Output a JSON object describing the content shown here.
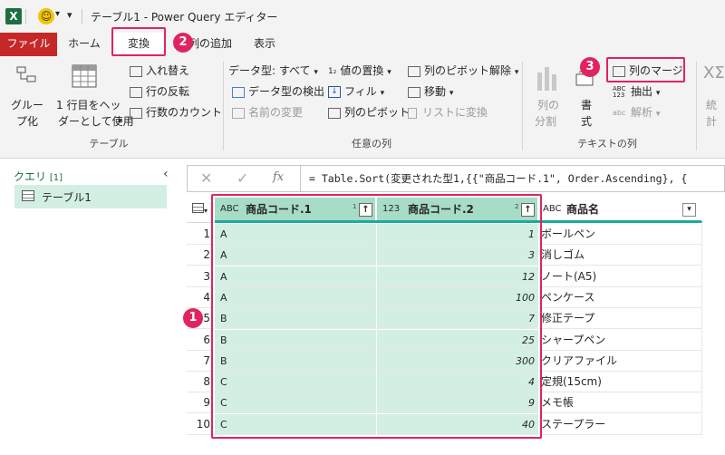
{
  "titlebar": {
    "title": "テーブル1 - Power Query エディター",
    "qat_dropdown": "▾"
  },
  "tabs": {
    "file": "ファイル",
    "home": "ホーム",
    "transform": "変換",
    "add_column": "列の追加",
    "view": "表示"
  },
  "ribbon": {
    "group_by": [
      "グルー",
      "プ化"
    ],
    "use_first_row": [
      "1 行目をヘッ",
      "ダーとして使用"
    ],
    "transpose": "入れ替え",
    "reverse_rows": "行の反転",
    "count_rows": "行数のカウント",
    "data_type": "データ型: すべて",
    "detect_type": "データ型の検出",
    "rename": "名前の変更",
    "replace_values": "値の置換",
    "fill": "フィル",
    "pivot_column": "列のピボット",
    "unpivot": "列のピボット解除",
    "move": "移動",
    "to_list": "リストに変換",
    "split_column": [
      "列の",
      "分割"
    ],
    "format": [
      "書",
      "式"
    ],
    "merge_columns": "列のマージ",
    "extract": "抽出",
    "parse": "解析",
    "stats": [
      "統",
      "計"
    ],
    "extract_icon_label": "ABC\n123",
    "groups": {
      "table": "テーブル",
      "any_column": "任意の列",
      "text_column": "テキストの列"
    }
  },
  "queries": {
    "title": "クエリ",
    "count": "[1]",
    "items": [
      "テーブル1"
    ]
  },
  "formula": {
    "fx": "fx",
    "text": "= Table.Sort(変更された型1,{{\"商品コード.1\", Order.Ascending}, {"
  },
  "grid": {
    "columns": [
      {
        "type": "ABC",
        "name": "商品コード.1",
        "sort_index": "1"
      },
      {
        "type": "123",
        "name": "商品コード.2",
        "sort_index": "2"
      },
      {
        "type": "ABC",
        "name": "商品名"
      }
    ],
    "rows": [
      {
        "n": "1",
        "c1": "A",
        "c2": "1",
        "c3": "ボールペン"
      },
      {
        "n": "2",
        "c1": "A",
        "c2": "3",
        "c3": "消しゴム"
      },
      {
        "n": "3",
        "c1": "A",
        "c2": "12",
        "c3": "ノート(A5)"
      },
      {
        "n": "4",
        "c1": "A",
        "c2": "100",
        "c3": "ペンケース"
      },
      {
        "n": "5",
        "c1": "B",
        "c2": "7",
        "c3": "修正テープ"
      },
      {
        "n": "6",
        "c1": "B",
        "c2": "25",
        "c3": "シャープペン"
      },
      {
        "n": "7",
        "c1": "B",
        "c2": "300",
        "c3": "クリアファイル"
      },
      {
        "n": "8",
        "c1": "C",
        "c2": "4",
        "c3": "定規(15cm)"
      },
      {
        "n": "9",
        "c1": "C",
        "c2": "9",
        "c3": "メモ帳"
      },
      {
        "n": "10",
        "c1": "C",
        "c2": "40",
        "c3": "ステープラー"
      }
    ]
  },
  "annotations": {
    "step1": "1",
    "step2": "2",
    "step3": "3"
  },
  "colors": {
    "accent_red": "#e0245e",
    "file_tab": "#c62828",
    "selected_col": "#d3efe4",
    "header_green": "#a7dcc7"
  }
}
